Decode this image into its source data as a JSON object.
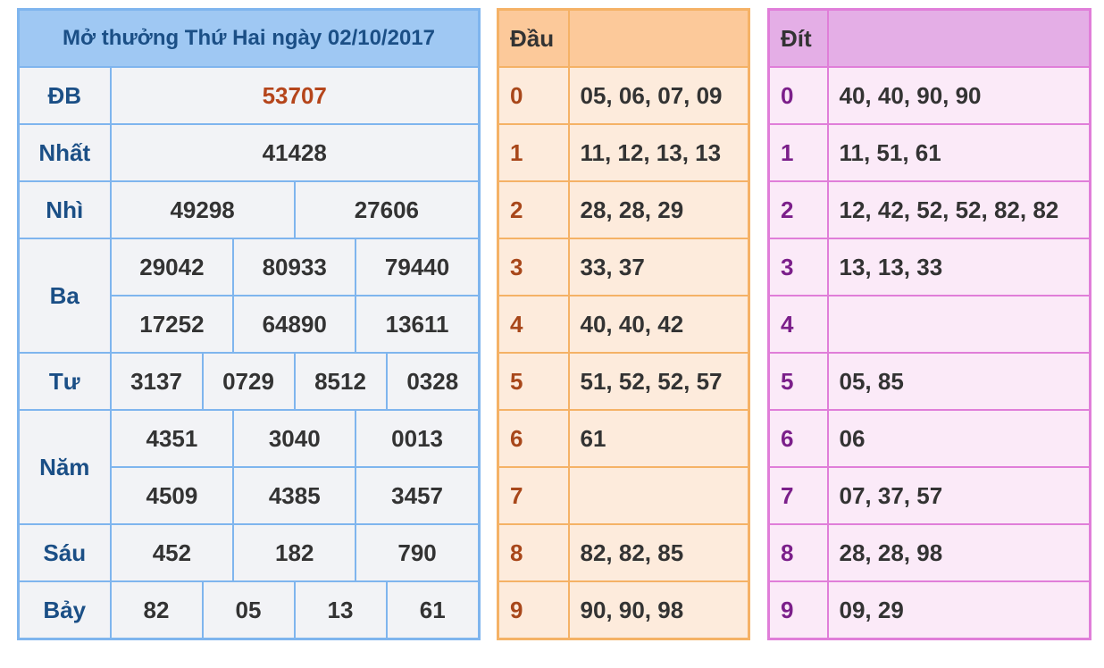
{
  "results": {
    "title": "Mở thưởng Thứ Hai ngày 02/10/2017",
    "db": {
      "label": "ĐB",
      "values": [
        "53707"
      ]
    },
    "nhat": {
      "label": "Nhất",
      "values": [
        "41428"
      ]
    },
    "nhi": {
      "label": "Nhì",
      "values": [
        "49298",
        "27606"
      ]
    },
    "ba": {
      "label": "Ba",
      "values": [
        "29042",
        "80933",
        "79440",
        "17252",
        "64890",
        "13611"
      ]
    },
    "tu": {
      "label": "Tư",
      "values": [
        "3137",
        "0729",
        "8512",
        "0328"
      ]
    },
    "nam": {
      "label": "Năm",
      "values": [
        "4351",
        "3040",
        "0013",
        "4509",
        "4385",
        "3457"
      ]
    },
    "sau": {
      "label": "Sáu",
      "values": [
        "452",
        "182",
        "790"
      ]
    },
    "bay": {
      "label": "Bảy",
      "values": [
        "82",
        "05",
        "13",
        "61"
      ]
    }
  },
  "dau": {
    "header": "Đầu",
    "rows": [
      {
        "key": "0",
        "values": "05, 06, 07, 09"
      },
      {
        "key": "1",
        "values": "11, 12, 13, 13"
      },
      {
        "key": "2",
        "values": "28, 28, 29"
      },
      {
        "key": "3",
        "values": "33, 37"
      },
      {
        "key": "4",
        "values": "40, 40, 42"
      },
      {
        "key": "5",
        "values": "51, 52, 52, 57"
      },
      {
        "key": "6",
        "values": "61"
      },
      {
        "key": "7",
        "values": ""
      },
      {
        "key": "8",
        "values": "82, 82, 85"
      },
      {
        "key": "9",
        "values": "90, 90, 98"
      }
    ]
  },
  "dit": {
    "header": "Đít",
    "rows": [
      {
        "key": "0",
        "values": "40, 40, 90, 90"
      },
      {
        "key": "1",
        "values": "11, 51, 61"
      },
      {
        "key": "2",
        "values": "12, 42, 52, 52, 82, 82"
      },
      {
        "key": "3",
        "values": "13, 13, 33"
      },
      {
        "key": "4",
        "values": ""
      },
      {
        "key": "5",
        "values": "05, 85"
      },
      {
        "key": "6",
        "values": "06"
      },
      {
        "key": "7",
        "values": "07, 37, 57"
      },
      {
        "key": "8",
        "values": "28, 28, 98"
      },
      {
        "key": "9",
        "values": "09, 29"
      }
    ]
  },
  "colors": {
    "results_border": "#7fb5ee",
    "results_header": "#9fc8f3",
    "label_text": "#1b4f86",
    "special_prize": "#b5451b",
    "dau_border": "#f5b266",
    "dit_border": "#e07ed9"
  }
}
